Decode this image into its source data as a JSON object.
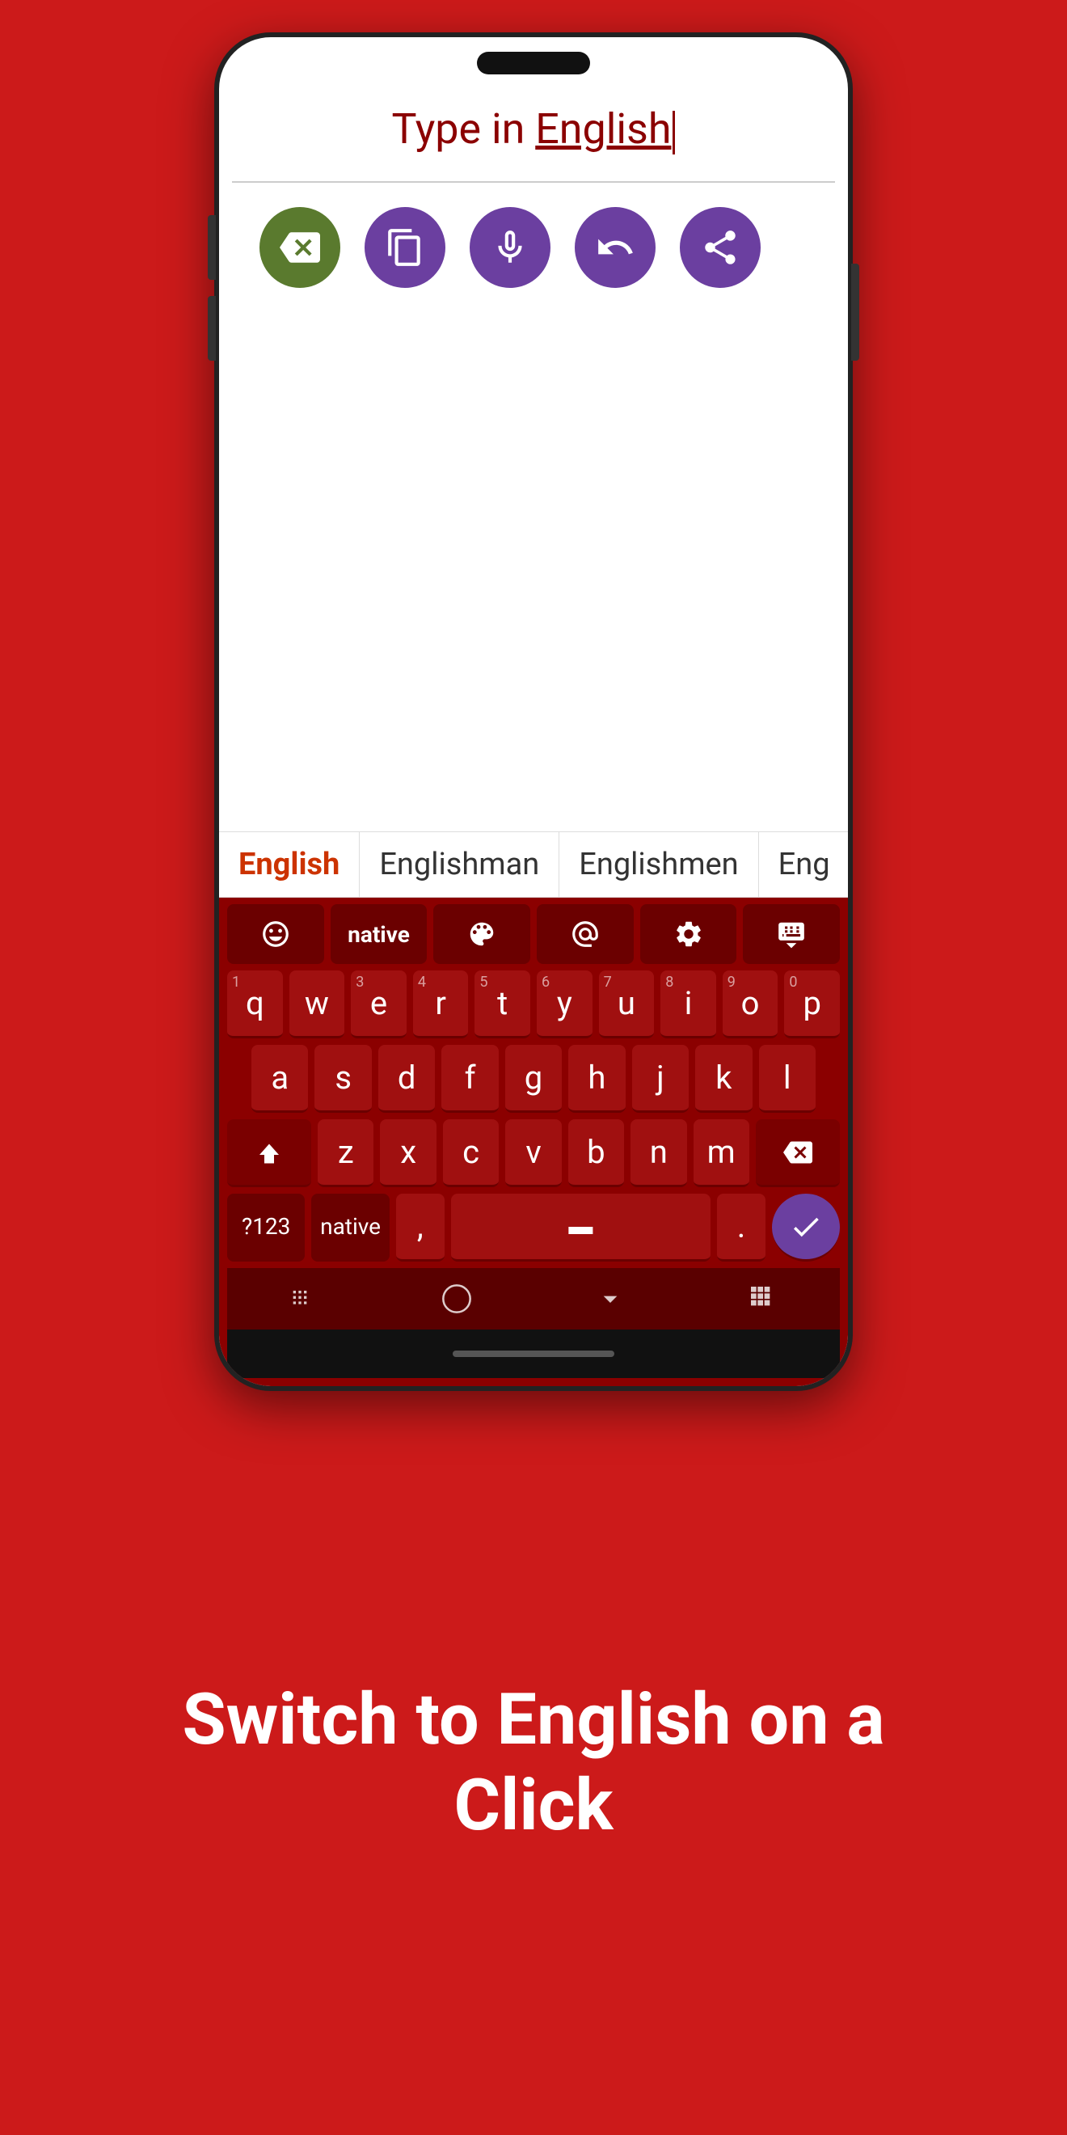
{
  "phone": {
    "text_input": {
      "prefix": "Type in ",
      "highlighted_word": "English",
      "has_cursor": true
    },
    "action_buttons": [
      {
        "id": "delete",
        "icon": "backspace",
        "bg": "olive",
        "label": "Delete"
      },
      {
        "id": "copy",
        "icon": "copy",
        "bg": "purple",
        "label": "Copy"
      },
      {
        "id": "mic",
        "icon": "microphone",
        "bg": "purple",
        "label": "Microphone"
      },
      {
        "id": "undo",
        "icon": "undo",
        "bg": "purple",
        "label": "Undo"
      },
      {
        "id": "share",
        "icon": "share",
        "bg": "purple",
        "label": "Share"
      }
    ],
    "autocomplete": [
      {
        "text": "English",
        "active": true
      },
      {
        "text": "Englishman",
        "active": false
      },
      {
        "text": "Englishmen",
        "active": false
      },
      {
        "text": "Eng",
        "active": false
      }
    ],
    "keyboard": {
      "toolbar": [
        {
          "id": "emoji",
          "icon": "emoji",
          "label": "Emoji"
        },
        {
          "id": "native",
          "text": "native",
          "label": "Native"
        },
        {
          "id": "palette",
          "icon": "palette",
          "label": "Theme"
        },
        {
          "id": "at",
          "icon": "at",
          "label": "At Symbol"
        },
        {
          "id": "settings",
          "icon": "gear",
          "label": "Settings"
        },
        {
          "id": "keyboard-hide",
          "icon": "keyboard-hide",
          "label": "Hide Keyboard"
        }
      ],
      "rows": [
        {
          "keys": [
            {
              "label": "q",
              "num": "1"
            },
            {
              "label": "w",
              "num": ""
            },
            {
              "label": "e",
              "num": "3"
            },
            {
              "label": "r",
              "num": "4"
            },
            {
              "label": "t",
              "num": "5"
            },
            {
              "label": "y",
              "num": "6"
            },
            {
              "label": "u",
              "num": "7"
            },
            {
              "label": "i",
              "num": "8"
            },
            {
              "label": "o",
              "num": "9"
            },
            {
              "label": "p",
              "num": "0"
            }
          ]
        },
        {
          "keys": [
            {
              "label": "a"
            },
            {
              "label": "s"
            },
            {
              "label": "d"
            },
            {
              "label": "f"
            },
            {
              "label": "g"
            },
            {
              "label": "h"
            },
            {
              "label": "j"
            },
            {
              "label": "k"
            },
            {
              "label": "l"
            }
          ]
        },
        {
          "keys": [
            {
              "label": "⇧",
              "special": "shift"
            },
            {
              "label": "z"
            },
            {
              "label": "x"
            },
            {
              "label": "c"
            },
            {
              "label": "v"
            },
            {
              "label": "b"
            },
            {
              "label": "n"
            },
            {
              "label": "m"
            },
            {
              "label": "⌫",
              "special": "backspace"
            }
          ]
        },
        {
          "keys": [
            {
              "label": "?123",
              "special": "numpad"
            },
            {
              "label": "native",
              "special": "lang"
            },
            {
              "label": ","
            },
            {
              "label": " ",
              "special": "space"
            },
            {
              "label": "."
            },
            {
              "label": "✓",
              "special": "enter"
            }
          ]
        }
      ],
      "nav": [
        "|||",
        "○",
        "∨",
        "⊞"
      ]
    }
  },
  "bottom_text": {
    "line1": "Switch to English on a",
    "line2": "Click"
  },
  "colors": {
    "bg_red": "#cc1a1a",
    "keyboard_red": "#8b0000",
    "key_red": "#a01010",
    "dark_red": "#6b0000",
    "purple": "#6b3fa0",
    "olive": "#5a7a2e"
  }
}
